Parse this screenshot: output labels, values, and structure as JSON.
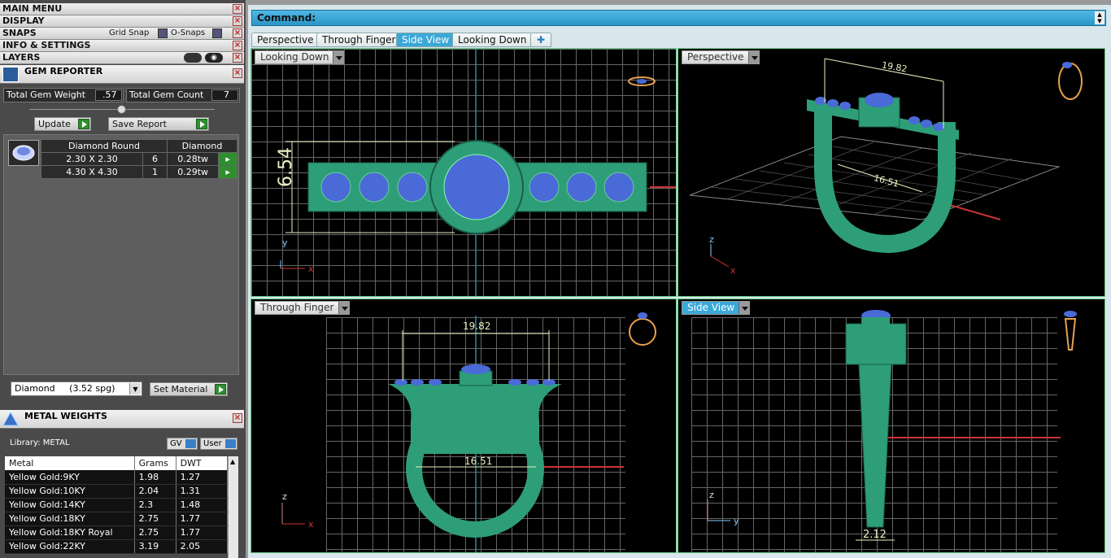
{
  "left_panel": {
    "menus": [
      "MAIN MENU",
      "DISPLAY",
      "SNAPS",
      "INFO & SETTINGS",
      "LAYERS"
    ],
    "snaps": {
      "grid_snap": "Grid Snap",
      "o_snaps": "O-Snaps"
    },
    "gem_reporter": {
      "title": "GEM REPORTER",
      "total_weight_label": "Total Gem Weight",
      "total_weight": ".57",
      "total_count_label": "Total Gem Count",
      "total_count": "7",
      "update_label": "Update",
      "save_report_label": "Save Report",
      "columns": [
        "Diamond Round",
        "Diamond"
      ],
      "rows": [
        {
          "size": "2.30 X 2.30",
          "count": "6",
          "weight": "0.28tw"
        },
        {
          "size": "4.30 X 4.30",
          "count": "1",
          "weight": "0.29tw"
        }
      ],
      "material_select": "Diamond     (3.52 spg)",
      "set_material_label": "Set Material"
    },
    "metal_weights": {
      "title": "METAL WEIGHTS",
      "library": "Library: METAL",
      "gv": "GV",
      "user": "User",
      "columns": [
        "Metal",
        "Grams",
        "DWT"
      ],
      "rows": [
        [
          "Yellow Gold:9KY",
          "1.98",
          "1.27"
        ],
        [
          "Yellow Gold:10KY",
          "2.04",
          "1.31"
        ],
        [
          "Yellow Gold:14KY",
          "2.3",
          "1.48"
        ],
        [
          "Yellow Gold:18KY",
          "2.75",
          "1.77"
        ],
        [
          "Yellow Gold:18KY Royal",
          "2.75",
          "1.77"
        ],
        [
          "Yellow Gold:22KY",
          "3.19",
          "2.05"
        ]
      ]
    }
  },
  "command_bar": {
    "label": "Command:"
  },
  "tabs": [
    "Perspective",
    "Through Finger",
    "Side View",
    "Looking Down"
  ],
  "viewports": {
    "looking_down": {
      "label": "Looking Down",
      "dimension": "6.54"
    },
    "perspective": {
      "label": "Perspective",
      "dim_top": "19.82",
      "dim_inner": "16.51"
    },
    "through_finger": {
      "label": "Through Finger",
      "dim_top": "19.82",
      "dim_inner": "16.51"
    },
    "side_view": {
      "label": "Side View",
      "dim_bottom": "2.12"
    }
  },
  "colors": {
    "accent": "#3aa8d8",
    "model": "#2e9e78",
    "gem": "#4a6ad8",
    "dimension": "#e8f0c0"
  }
}
